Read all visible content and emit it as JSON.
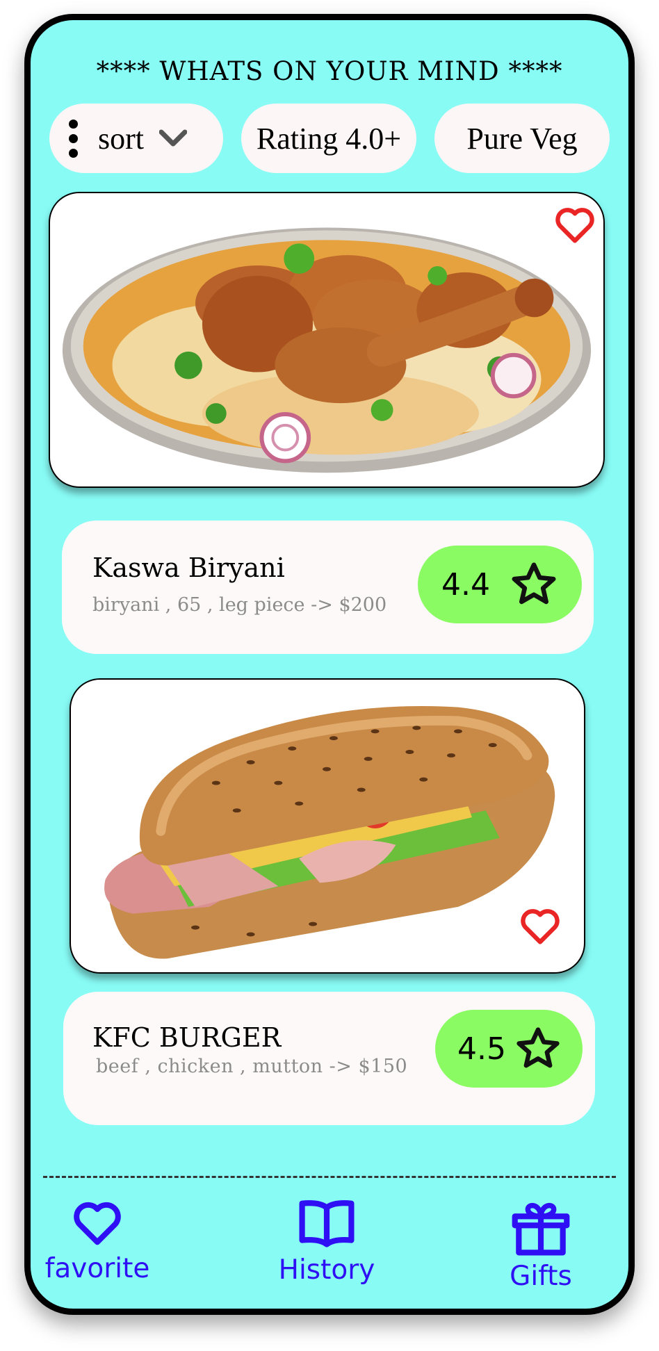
{
  "header": {
    "title": "**** WHATS ON YOUR MIND ****"
  },
  "filters": {
    "sort_label": "sort",
    "rating_label": "Rating 4.0+",
    "veg_label": "Pure Veg"
  },
  "restaurants": [
    {
      "name": "Kaswa Biryani",
      "description": "biryani , 65 , leg piece -> $200",
      "rating": "4.4",
      "image": "chicken-biryani-plate"
    },
    {
      "name": "KFC BURGER",
      "description": "beef , chicken , mutton -> $150",
      "rating": "4.5",
      "image": "ham-cheese-sub-sandwich"
    }
  ],
  "bottom_nav": {
    "favorite": "favorite",
    "history": "History",
    "gifts": "Gifts"
  },
  "colors": {
    "background": "#88fbf5",
    "card": "#fdf9f9",
    "rating": "#8bfb63",
    "heart": "#ea2525",
    "nav": "#2f10f5"
  }
}
